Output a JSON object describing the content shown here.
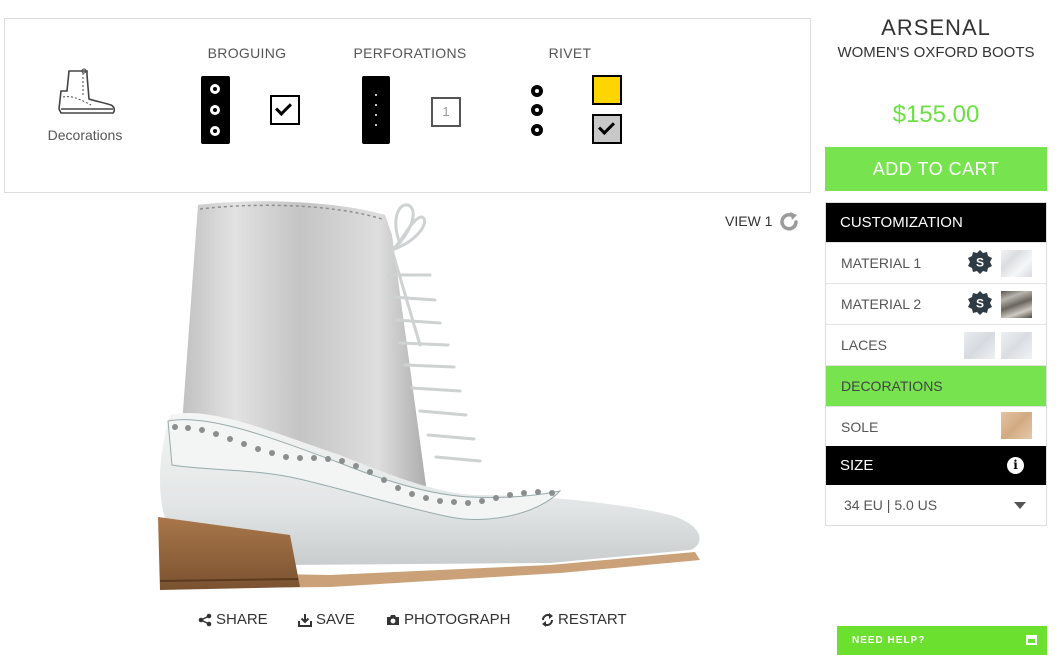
{
  "decorations": {
    "label": "Decorations",
    "groups": {
      "broguing": {
        "title": "BROGUING"
      },
      "perforations": {
        "title": "PERFORATIONS",
        "count_value": "1"
      },
      "rivet": {
        "title": "RIVET"
      }
    },
    "rivet_colors": {
      "yellow": "#ffd500",
      "silver": "#c8c8c8"
    }
  },
  "viewer": {
    "view_label": "VIEW 1",
    "toolbar": {
      "share": "SHARE",
      "save": "SAVE",
      "photograph": "PHOTOGRAPH",
      "restart": "RESTART"
    }
  },
  "product": {
    "title": "ARSENAL",
    "subtitle": "WOMEN'S OXFORD BOOTS",
    "price": "$155.00",
    "add_to_cart": "ADD TO CART"
  },
  "customization": {
    "header": "CUSTOMIZATION",
    "rows": [
      {
        "label": "MATERIAL 1",
        "badge": "S"
      },
      {
        "label": "MATERIAL 2",
        "badge": "S"
      },
      {
        "label": "LACES"
      },
      {
        "label": "DECORATIONS"
      },
      {
        "label": "SOLE"
      }
    ],
    "size_header": "SIZE",
    "size_value": "34 EU | 5.0 US"
  },
  "help": {
    "label": "NEED HELP?"
  },
  "colors": {
    "accent": "#76e34f",
    "price": "#6ce043",
    "header_bg": "#000000"
  }
}
